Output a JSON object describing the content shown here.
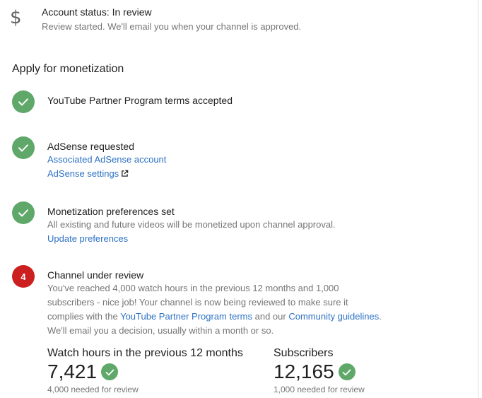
{
  "account_status": {
    "icon": "dollar-icon",
    "title": "Account status: In review",
    "subtitle": "Review started. We'll email you when your channel is approved."
  },
  "section_heading": "Apply for monetization",
  "steps": [
    {
      "title": "YouTube Partner Program terms accepted"
    },
    {
      "title": "AdSense requested",
      "link1": "Associated AdSense account",
      "link2": "AdSense settings"
    },
    {
      "title": "Monetization preferences set",
      "text": "All existing and future videos will be monetized upon channel approval.",
      "link1": "Update preferences"
    },
    {
      "number": "4",
      "title": "Channel under review",
      "text_part1": "You've reached 4,000 watch hours in the previous 12 months and 1,000 subscribers - nice job! Your channel is now being reviewed to make sure it complies with the ",
      "link_terms": "YouTube Partner Program terms",
      "text_part2": " and our ",
      "link_guidelines": "Community guidelines",
      "text_part3": ".",
      "text_part4": "We'll email you a decision, usually within a month or so."
    }
  ],
  "metrics": {
    "watch_hours": {
      "label": "Watch hours in the previous 12 months",
      "value": "7,421",
      "note": "4,000 needed for review"
    },
    "subscribers": {
      "label": "Subscribers",
      "value": "12,165",
      "note": "1,000 needed for review"
    }
  },
  "colors": {
    "success": "#5fa86a",
    "alert": "#cc1f1f",
    "link": "#2d72c4"
  }
}
